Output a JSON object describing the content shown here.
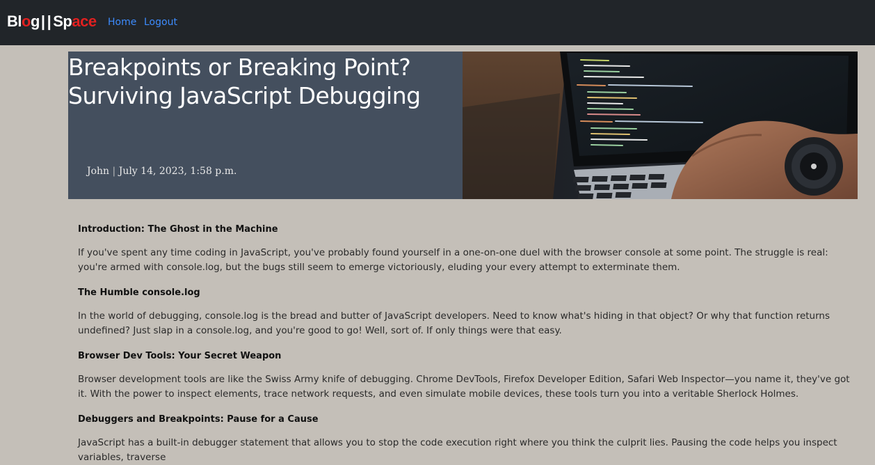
{
  "nav": {
    "logo_left": "Blog",
    "logo_right": "Space",
    "home_label": "Home",
    "logout_label": "Logout"
  },
  "hero": {
    "title": "Breakpoints or Breaking Point? Surviving JavaScript Debugging",
    "author": "John",
    "separator": "|",
    "date": "July 14, 2023, 1:58 p.m."
  },
  "article": {
    "sections": [
      {
        "heading": "Introduction: The Ghost in the Machine",
        "body": "If you've spent any time coding in JavaScript, you've probably found yourself in a one-on-one duel with the browser console at some point. The struggle is real: you're armed with console.log, but the bugs still seem to emerge victoriously, eluding your every attempt to exterminate them."
      },
      {
        "heading": "The Humble console.log",
        "body": "In the world of debugging, console.log is the bread and butter of JavaScript developers. Need to know what's hiding in that object? Or why that function returns undefined? Just slap in a console.log, and you're good to go! Well, sort of. If only things were that easy."
      },
      {
        "heading": "Browser Dev Tools: Your Secret Weapon",
        "body": "Browser development tools are like the Swiss Army knife of debugging. Chrome DevTools, Firefox Developer Edition, Safari Web Inspector—you name it, they've got it. With the power to inspect elements, trace network requests, and even simulate mobile devices, these tools turn you into a veritable Sherlock Holmes."
      },
      {
        "heading": "Debuggers and Breakpoints: Pause for a Cause",
        "body": "JavaScript has a built-in debugger statement that allows you to stop the code execution right where you think the culprit lies. Pausing the code helps you inspect variables, traverse"
      }
    ]
  },
  "colors": {
    "navbar_bg": "#212529",
    "page_bg": "#c4bfb8",
    "hero_bg": "#444f5e",
    "link": "#3d8bfd",
    "logo_accent": "#e02020"
  },
  "icons": {
    "hero_image": "laptop-code-photo"
  }
}
